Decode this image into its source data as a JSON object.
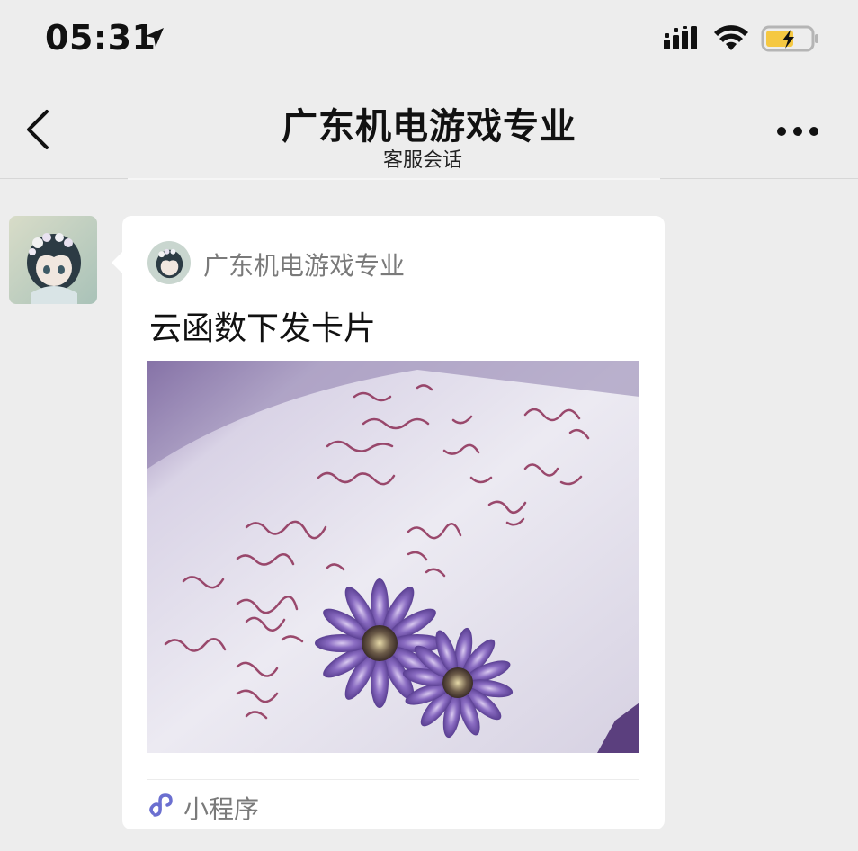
{
  "status_bar": {
    "time": "05:31",
    "icons": [
      "location-arrow-icon",
      "cellular-signal-icon",
      "wifi-icon",
      "battery-charging-icon"
    ],
    "battery_color": "#f5c842"
  },
  "nav": {
    "title": "广东机电游戏专业",
    "subtitle": "客服会话",
    "back_icon": "chevron-left-icon",
    "more_icon": "more-horizontal-icon"
  },
  "message": {
    "sender_avatar": "anime-girl-avatar",
    "card": {
      "source_name": "广东机电游戏专业",
      "title": "云函数下发卡片",
      "image": "handwritten-notebook-with-purple-daisies",
      "footer_label": "小程序",
      "footer_icon": "mini-program-icon",
      "footer_icon_color": "#6b6fd0"
    }
  }
}
